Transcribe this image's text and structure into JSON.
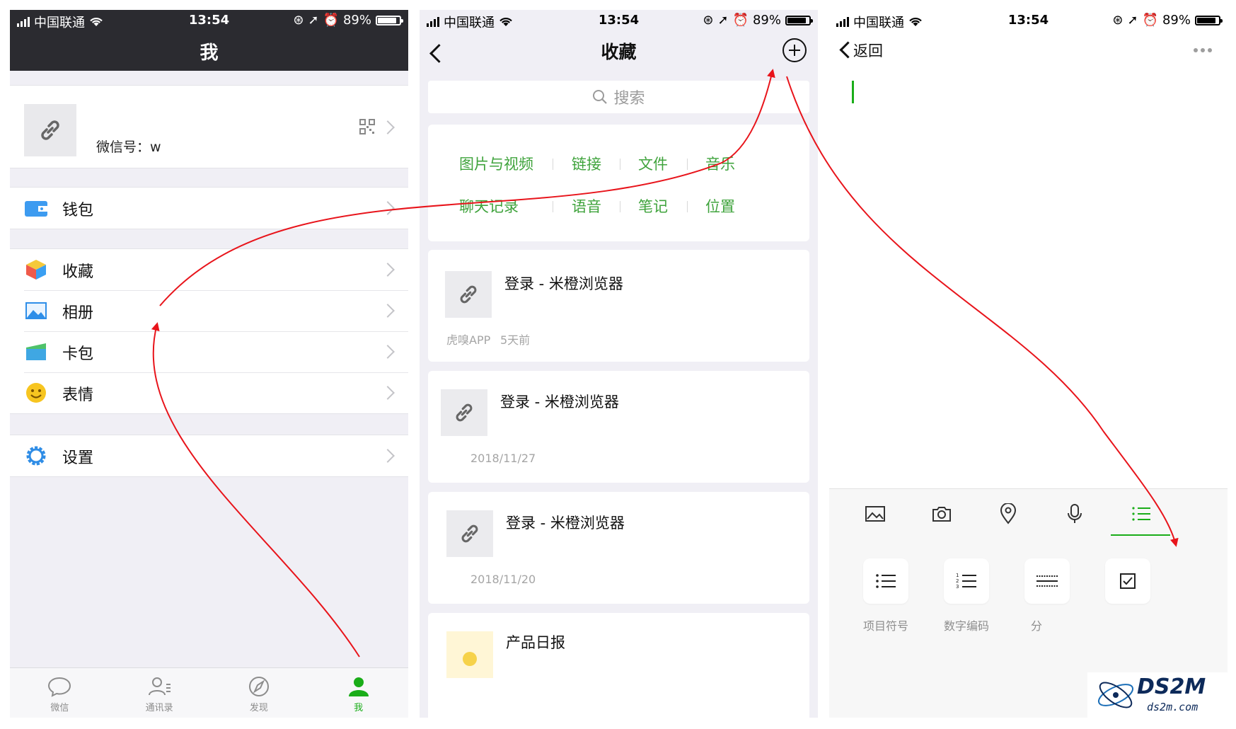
{
  "status_bar": {
    "carrier": "中国联通",
    "time": "13:54",
    "battery": "89%"
  },
  "panel_me": {
    "title": "我",
    "wechat_id": "微信号：w",
    "menu": [
      {
        "label": "钱包"
      },
      {
        "label": "收藏"
      },
      {
        "label": "相册"
      },
      {
        "label": "卡包"
      },
      {
        "label": "表情"
      },
      {
        "label": "设置"
      }
    ],
    "tabs": [
      {
        "label": "微信"
      },
      {
        "label": "通讯录"
      },
      {
        "label": "发现"
      },
      {
        "label": "我"
      }
    ]
  },
  "panel_favorites": {
    "title": "收藏",
    "search_placeholder": "搜索",
    "filters": [
      "图片与视频",
      "链接",
      "文件",
      "音乐",
      "聊天记录",
      "语音",
      "笔记",
      "位置"
    ],
    "items": [
      {
        "title": "登录 - 米橙浏览器",
        "source": "虎嗅APP",
        "time": "5天前"
      },
      {
        "title": "登录 - 米橙浏览器",
        "date": "2018/11/27"
      },
      {
        "title": "登录 - 米橙浏览器",
        "date": "2018/11/20"
      },
      {
        "title": "产品日报"
      }
    ]
  },
  "panel_note": {
    "back_label": "返回",
    "format_options": [
      "项目符号",
      "数字编码",
      "分"
    ]
  },
  "watermark": {
    "logo_text": "DS2M",
    "logo_url_text": "ds2m.com"
  },
  "colors": {
    "accent_green": "#1aad19",
    "filter_green": "#3fa33c",
    "arrow_red": "#e8141b",
    "dark_nav": "#2b2b30"
  }
}
